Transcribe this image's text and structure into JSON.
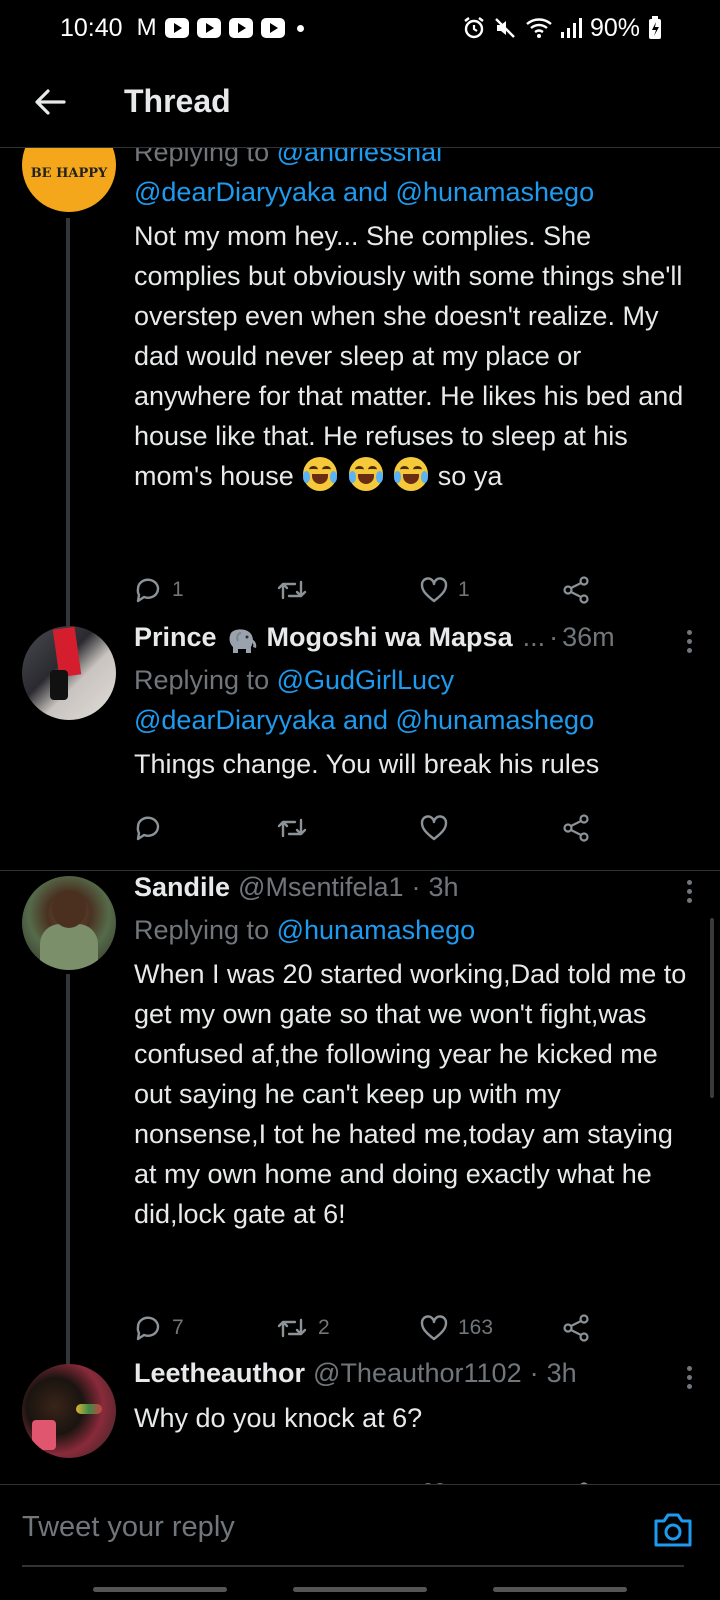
{
  "status_bar": {
    "time": "10:40",
    "battery": "90%",
    "mail_icon": "M"
  },
  "header": {
    "title": "Thread"
  },
  "tweets": [
    {
      "avatar_text": "BE HAPPY",
      "replying_prefix": "Replying to",
      "replying_to": "@andriesshai",
      "also_replying": "@dearDiaryyaka and @hunamashego",
      "body_main": "Not my mom hey... She complies. She complies but obviously with some things she'll overstep even when she doesn't realize. My dad would never sleep at my place or anywhere for that matter. He likes his bed and house like that. He refuses to sleep at his mom's house",
      "body_tail": "so ya",
      "reply_count": "1",
      "retweet_count": "",
      "like_count": "1"
    },
    {
      "name_first": "Prince",
      "name_rest": "Mogoshi wa Mapsa",
      "ellipsis": "...",
      "separator": "·",
      "time": "36m",
      "replying_prefix": "Replying to",
      "replying_to": "@GudGirlLucy",
      "also_replying": "@dearDiaryyaka and @hunamashego",
      "body": "Things change. You will break his rules",
      "reply_count": "",
      "retweet_count": "",
      "like_count": ""
    },
    {
      "name": "Sandile",
      "handle": "@Msentifela1",
      "separator": "·",
      "time": "3h",
      "replying_prefix": "Replying to",
      "replying_to": "@hunamashego",
      "body": "When I was 20 started working,Dad told me to get my own gate so that we won't fight,was confused af,the following year he kicked me out saying he can't keep up with my nonsense,I tot he hated me,today am staying at my own home and doing exactly what he did,lock gate at 6!",
      "reply_count": "7",
      "retweet_count": "2",
      "like_count": "163"
    },
    {
      "name": "Leetheauthor",
      "handle": "@Theauthor1102",
      "separator": "·",
      "time": "3h",
      "body": "Why do you knock at 6?"
    }
  ],
  "reply_bar": {
    "placeholder": "Tweet your reply"
  },
  "colors": {
    "background": "#000000",
    "accent": "#1d9bf0",
    "muted": "#71767b",
    "text": "#e7e9ea"
  },
  "icons": [
    "back-arrow-icon",
    "reply-icon",
    "retweet-icon",
    "like-icon",
    "share-icon",
    "more-icon",
    "camera-icon",
    "alarm-icon",
    "mute-icon",
    "wifi-icon",
    "signal-icon",
    "battery-icon"
  ]
}
